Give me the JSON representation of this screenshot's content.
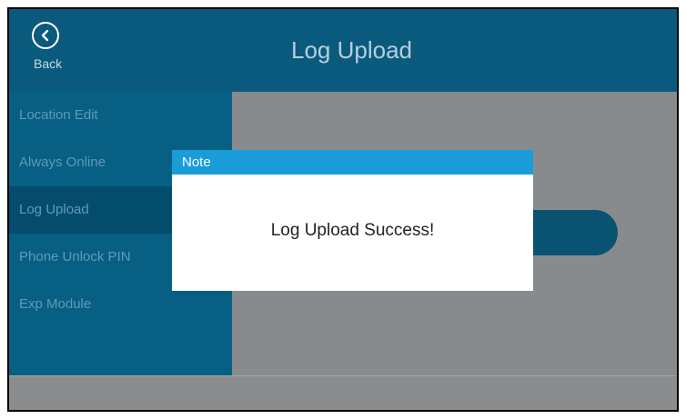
{
  "header": {
    "back_label": "Back",
    "title": "Log Upload"
  },
  "sidebar": {
    "items": [
      {
        "label": "Location Edit"
      },
      {
        "label": "Always Online"
      },
      {
        "label": "Log Upload",
        "selected": true
      },
      {
        "label": "Phone Unlock PIN"
      },
      {
        "label": "Exp Module"
      }
    ]
  },
  "dialog": {
    "title": "Note",
    "message": "Log Upload Success!"
  },
  "icons": {
    "back": "chevron-left-in-circle"
  },
  "colors": {
    "header_bg": "#0a5a7e",
    "sidebar_bg": "#075f83",
    "sidebar_selected_bg": "#044c6b",
    "content_bg": "#888b8d",
    "dialog_titlebar": "#1a9cd9",
    "dialog_bg": "#ffffff"
  }
}
